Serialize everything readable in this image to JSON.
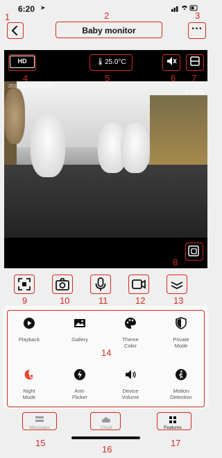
{
  "status_bar": {
    "time": "6:20",
    "icons": "••• ≈ ▮"
  },
  "header": {
    "title": "Baby monitor"
  },
  "video": {
    "quality": "HD",
    "temperature": "25.0°C",
    "bitrate": "0 KB/S",
    "timestamp": "2023-01-01 18:20:09"
  },
  "features": [
    {
      "label": "Playback",
      "icon": "play-circle-icon",
      "active": false
    },
    {
      "label": "Gallery",
      "icon": "gallery-icon",
      "active": false
    },
    {
      "label": "Theme\nColor",
      "icon": "palette-icon",
      "active": false
    },
    {
      "label": "Private\nMode",
      "icon": "shield-icon",
      "active": false
    },
    {
      "label": "Night\nMode",
      "icon": "night-mode-icon",
      "active": true
    },
    {
      "label": "Anti-\nFlicker",
      "icon": "flash-icon",
      "active": false
    },
    {
      "label": "Device\nVolume",
      "icon": "volume-icon",
      "active": false
    },
    {
      "label": "Motion\nDetection",
      "icon": "motion-icon",
      "active": false
    }
  ],
  "bottom_nav": [
    {
      "label": "Messages",
      "icon": "messages-icon",
      "active": false
    },
    {
      "label": "Cloud",
      "icon": "cloud-icon",
      "active": false
    },
    {
      "label": "Features",
      "icon": "features-icon",
      "active": true
    }
  ],
  "annotations": [
    "1",
    "2",
    "3",
    "4",
    "5",
    "6",
    "7",
    "8",
    "9",
    "10",
    "11",
    "12",
    "13",
    "14",
    "15",
    "16",
    "17"
  ],
  "colors": {
    "annotation": "#d32b1f",
    "active_feature": "#e8422e"
  }
}
